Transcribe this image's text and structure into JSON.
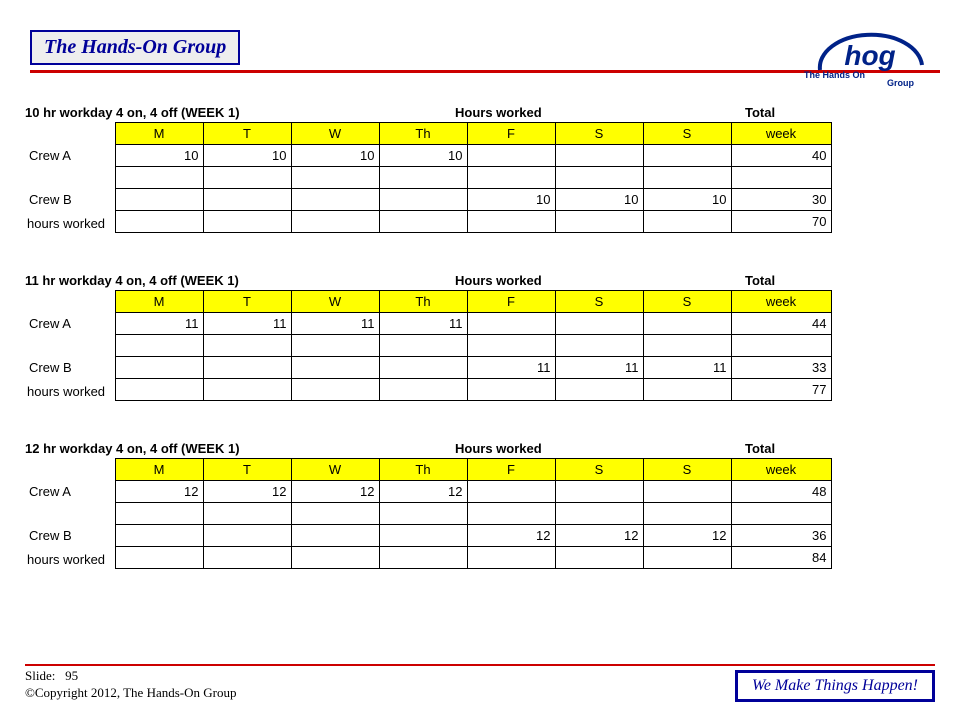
{
  "header": {
    "title": "The Hands-On Group",
    "logo": {
      "big": "hog",
      "line1": "The Hands On",
      "line2": "Group"
    }
  },
  "columns": [
    "M",
    "T",
    "W",
    "Th",
    "F",
    "S",
    "S",
    "week"
  ],
  "labels": {
    "hours_worked": "Hours worked",
    "total": "Total",
    "hours_worked_suffix": "hours worked",
    "crew_a": "Crew A",
    "crew_b": "Crew B"
  },
  "blocks": [
    {
      "title": "10 hr workday 4 on, 4 off  (WEEK 1)",
      "crew_a": {
        "M": 10,
        "T": 10,
        "W": 10,
        "Th": 10,
        "F": "",
        "S1": "",
        "S2": "",
        "week": 40
      },
      "crew_b": {
        "M": "",
        "T": "",
        "W": "",
        "Th": "",
        "F": 10,
        "S1": 10,
        "S2": 10,
        "week": 30
      },
      "grand": 70
    },
    {
      "title": "11 hr workday 4 on, 4 off  (WEEK 1)",
      "crew_a": {
        "M": 11,
        "T": 11,
        "W": 11,
        "Th": 11,
        "F": "",
        "S1": "",
        "S2": "",
        "week": 44
      },
      "crew_b": {
        "M": "",
        "T": "",
        "W": "",
        "Th": "",
        "F": 11,
        "S1": 11,
        "S2": 11,
        "week": 33
      },
      "grand": 77
    },
    {
      "title": "12 hr workday 4 on, 4 off  (WEEK 1)",
      "crew_a": {
        "M": 12,
        "T": 12,
        "W": 12,
        "Th": 12,
        "F": "",
        "S1": "",
        "S2": "",
        "week": 48
      },
      "crew_b": {
        "M": "",
        "T": "",
        "W": "",
        "Th": "",
        "F": 12,
        "S1": 12,
        "S2": 12,
        "week": 36
      },
      "grand": 84
    }
  ],
  "footer": {
    "slide_label": "Slide:",
    "slide_num": "95",
    "copyright": "©Copyright 2012, The Hands-On Group",
    "tagline": "We Make Things Happen!"
  }
}
